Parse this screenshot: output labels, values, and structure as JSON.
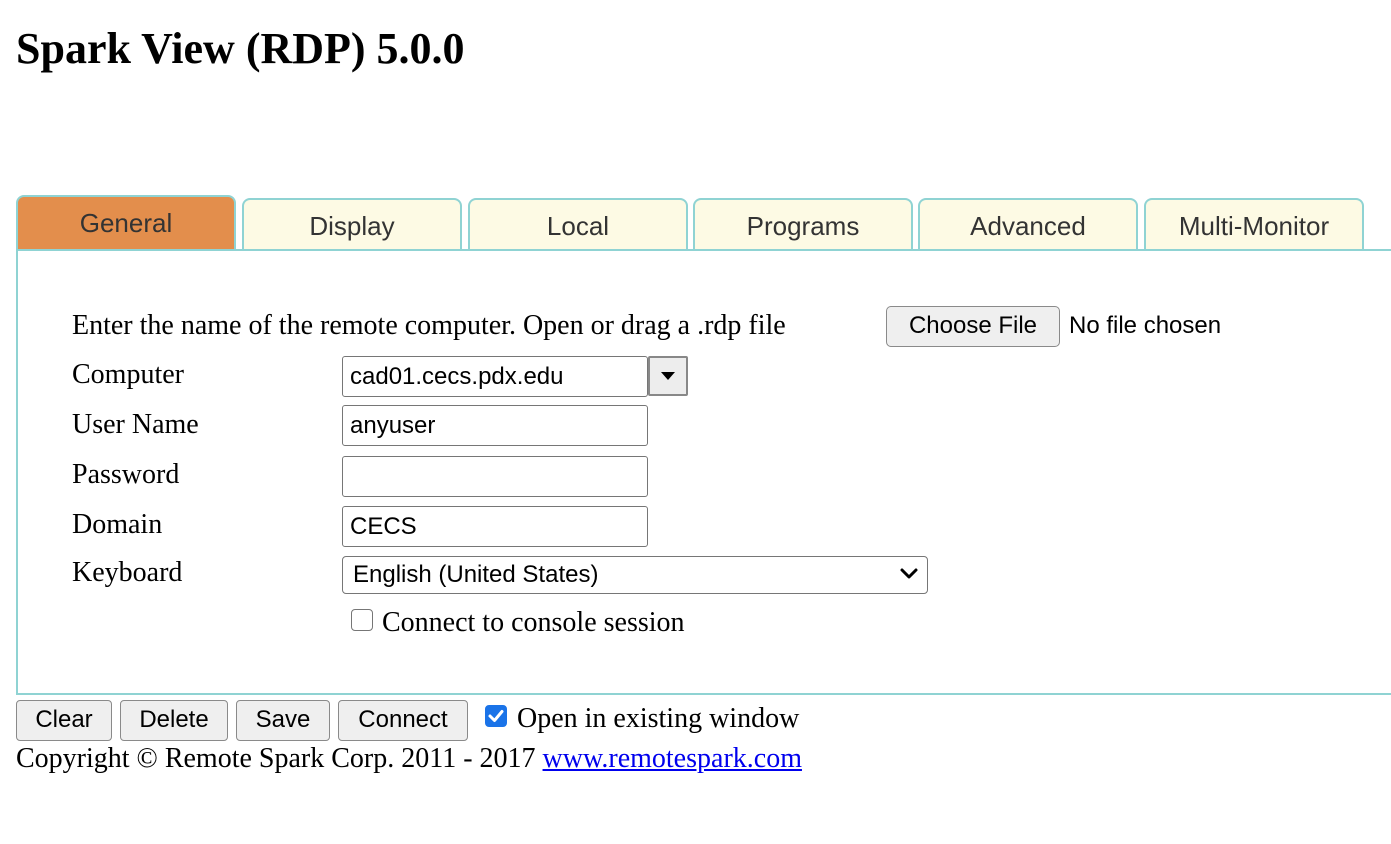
{
  "page": {
    "title": "Spark View (RDP) 5.0.0"
  },
  "tabs": [
    {
      "label": "General",
      "active": true
    },
    {
      "label": "Display",
      "active": false
    },
    {
      "label": "Local",
      "active": false
    },
    {
      "label": "Programs",
      "active": false
    },
    {
      "label": "Advanced",
      "active": false
    },
    {
      "label": "Multi-Monitor",
      "active": false
    }
  ],
  "general": {
    "intro_text": "Enter the name of the remote computer. Open or drag a .rdp file",
    "file_button_label": "Choose File",
    "file_status": "No file chosen",
    "computer_label": "Computer",
    "computer_value": "cad01.cecs.pdx.edu",
    "username_label": "User Name",
    "username_value": "anyuser",
    "password_label": "Password",
    "password_value": "",
    "domain_label": "Domain",
    "domain_value": "CECS",
    "keyboard_label": "Keyboard",
    "keyboard_value": "English (United States)",
    "console_label": "Connect to console session",
    "console_checked": false
  },
  "actions": {
    "clear_label": "Clear",
    "delete_label": "Delete",
    "save_label": "Save",
    "connect_label": "Connect",
    "open_existing_label": "Open in existing window",
    "open_existing_checked": true
  },
  "footer": {
    "copyright_text": "Copyright © Remote Spark Corp. 2011 - 2017",
    "link_text": "www.remotespark.com"
  },
  "colors": {
    "active_tab": "#e38e4c",
    "inactive_tab": "#fdfae4",
    "tab_border": "#8fd3d3",
    "checkbox_checked": "#1a73e8",
    "link": "#0000ee"
  },
  "icons": {
    "computer_dropdown": "triangle-down-icon",
    "keyboard_select": "chevron-down-icon",
    "checked": "checkmark-icon"
  }
}
